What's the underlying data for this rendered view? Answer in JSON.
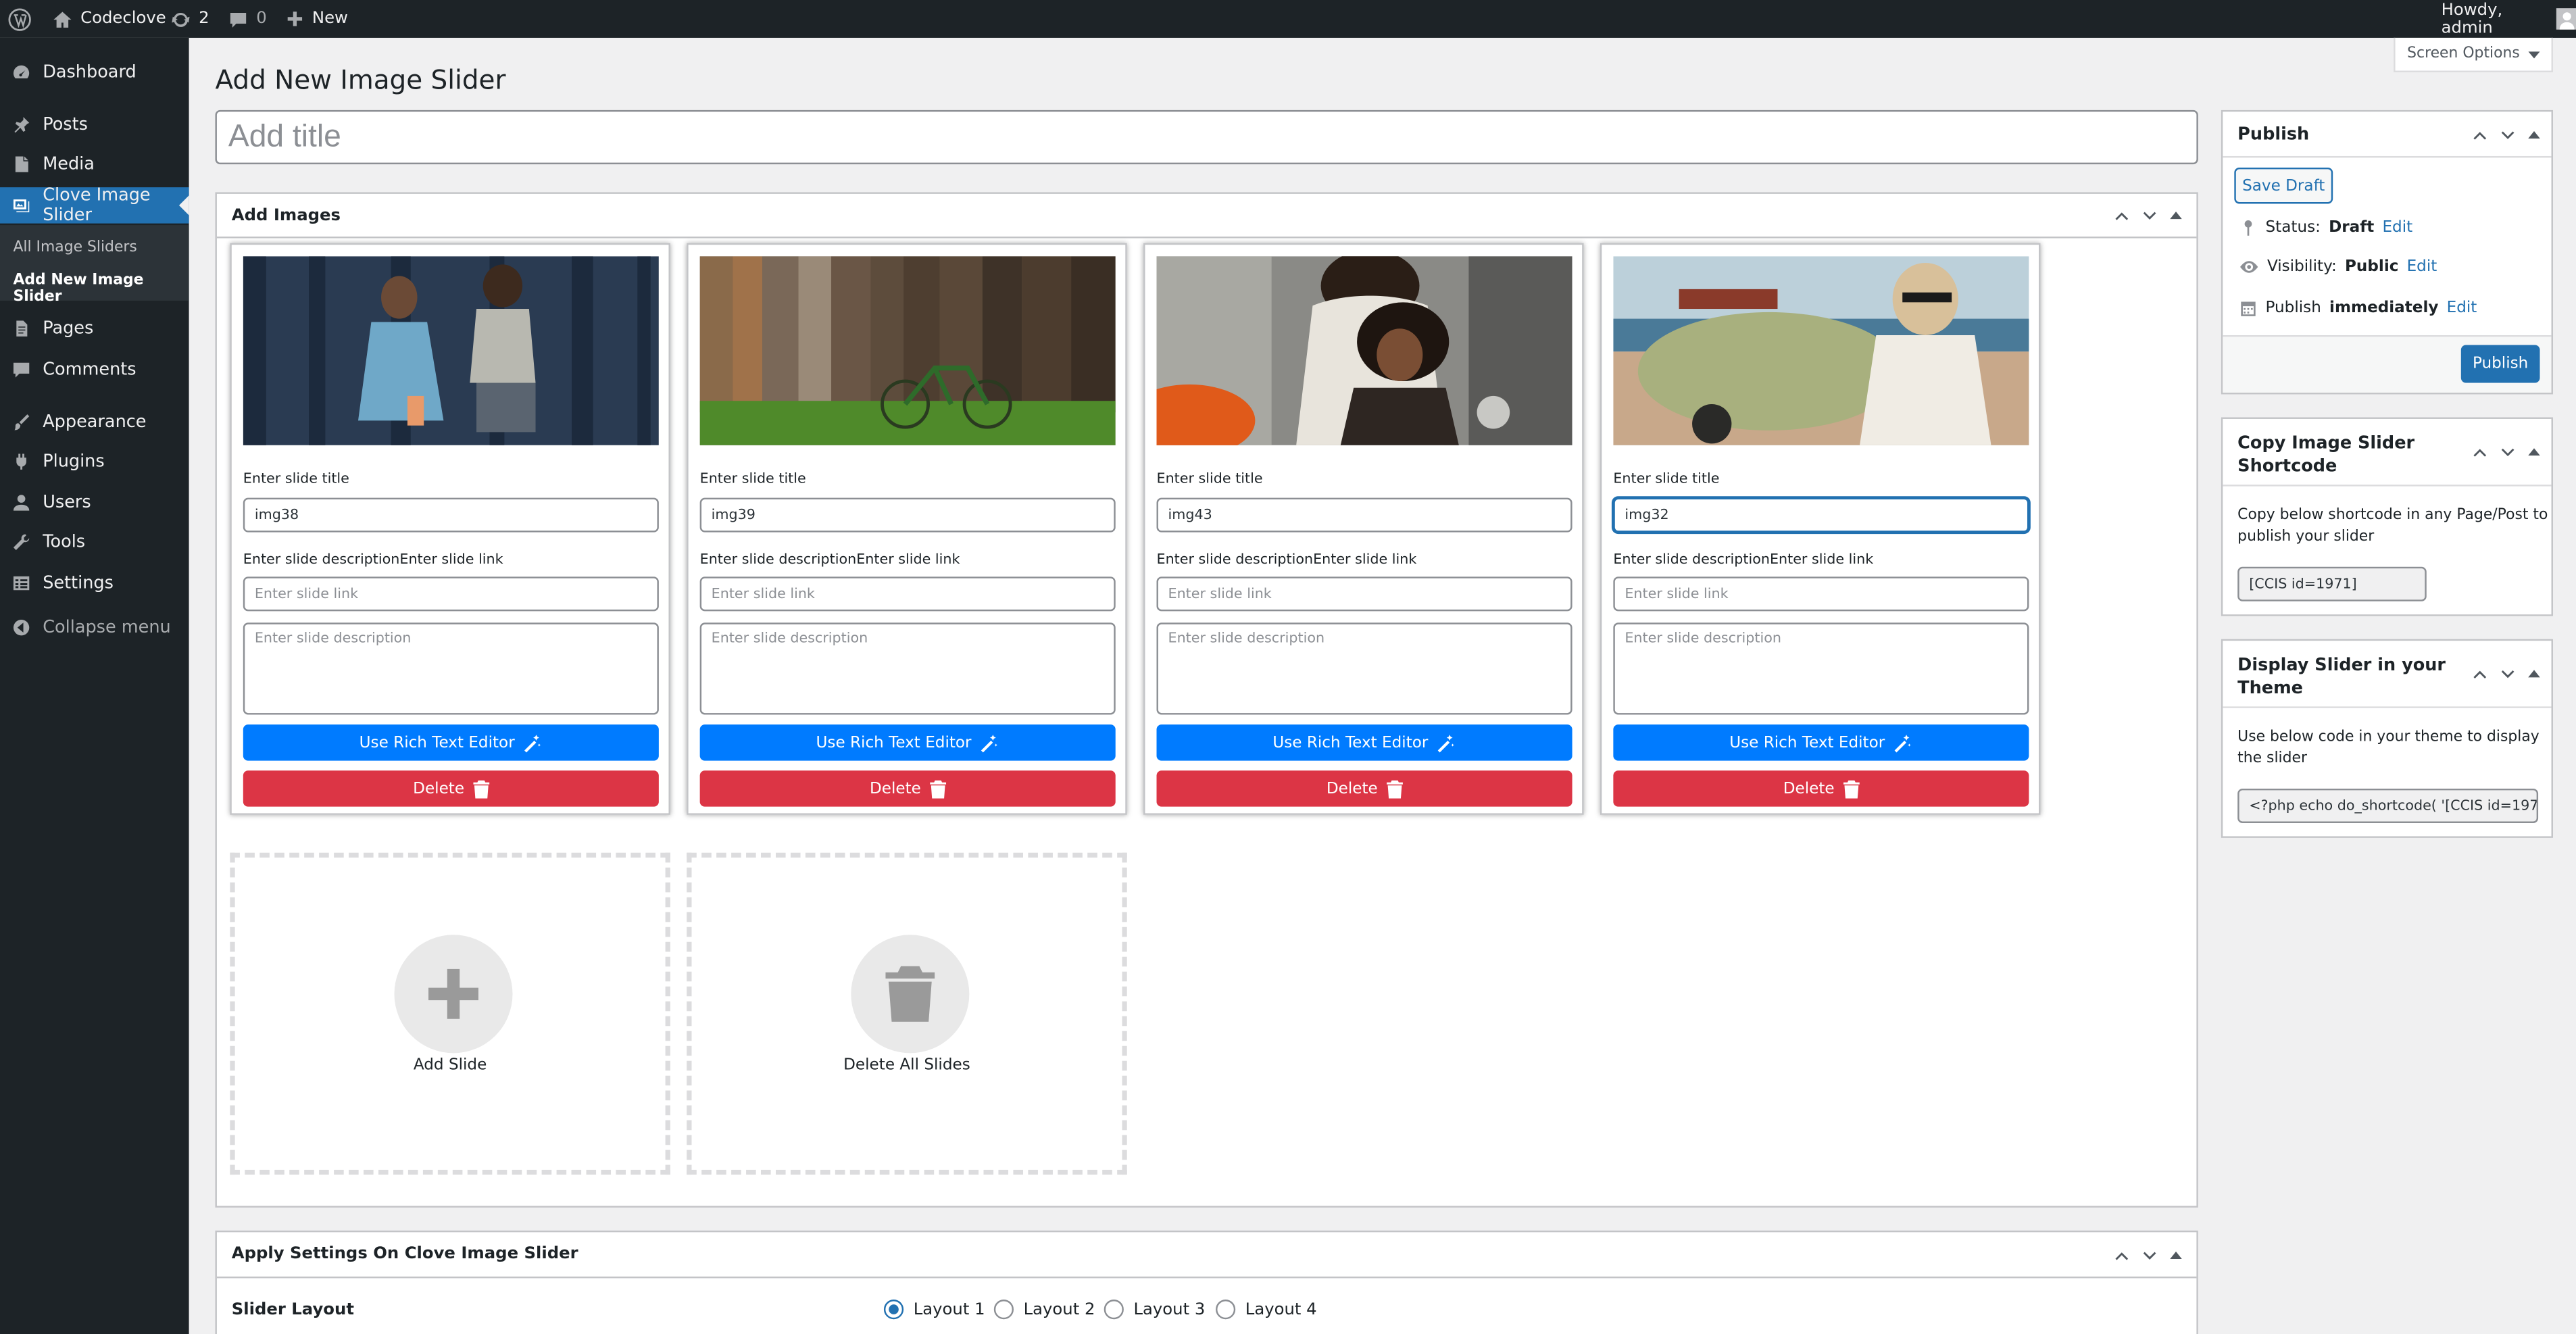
{
  "admin_bar": {
    "site_name": "Codeclove",
    "updates_count": "2",
    "comments_count": "0",
    "new_label": "New",
    "howdy": "Howdy, admin"
  },
  "sidebar": {
    "dashboard": "Dashboard",
    "posts": "Posts",
    "media": "Media",
    "clove": "Clove Image Slider",
    "sub_all": "All Image Sliders",
    "sub_add": "Add New Image Slider",
    "pages": "Pages",
    "comments": "Comments",
    "appearance": "Appearance",
    "plugins": "Plugins",
    "users": "Users",
    "tools": "Tools",
    "settings": "Settings",
    "collapse": "Collapse menu"
  },
  "screen_options": "Screen Options",
  "page_title": "Add New Image Slider",
  "title_placeholder": "Add title",
  "add_images": {
    "header": "Add Images",
    "title_label": "Enter slide title",
    "desc_link_label": "Enter slide descriptionEnter slide link",
    "link_placeholder": "Enter slide link",
    "desc_placeholder": "Enter slide description",
    "rich_text_label": "Use Rich Text Editor",
    "delete_label": "Delete",
    "slides": [
      {
        "title": "img38"
      },
      {
        "title": "img39"
      },
      {
        "title": "img43"
      },
      {
        "title": "img32"
      }
    ],
    "add_slide_label": "Add Slide",
    "delete_all_label": "Delete All Slides"
  },
  "publish": {
    "header": "Publish",
    "save_draft": "Save Draft",
    "status_label": "Status:",
    "status_value": "Draft",
    "visibility_label": "Visibility:",
    "visibility_value": "Public",
    "publish_label": "Publish",
    "publish_value": "immediately",
    "edit": "Edit",
    "publish_button": "Publish"
  },
  "shortcode_box": {
    "header_line1": "Copy Image Slider",
    "header_line2": "Shortcode",
    "desc_line1": "Copy below shortcode in any Page/Post to",
    "desc_line2": "publish your slider",
    "value": "[CCIS id=1971]"
  },
  "theme_box": {
    "header_line1": "Display Slider in your",
    "header_line2": "Theme",
    "desc_line1": "Use below code in your theme to display",
    "desc_line2": "the slider",
    "value": "<?php echo do_shortcode( '[CCIS id=197"
  },
  "settings_box": {
    "header": "Apply Settings On Clove Image Slider",
    "slider_layout_label": "Slider Layout",
    "layouts": [
      "Layout 1",
      "Layout 2",
      "Layout 3",
      "Layout 4"
    ],
    "selected_layout": "Layout 1"
  },
  "colors": {
    "admin_dark": "#1d2327",
    "wp_blue": "#2271b1",
    "bootstrap_blue": "#007bff",
    "bootstrap_red": "#dc3545"
  }
}
